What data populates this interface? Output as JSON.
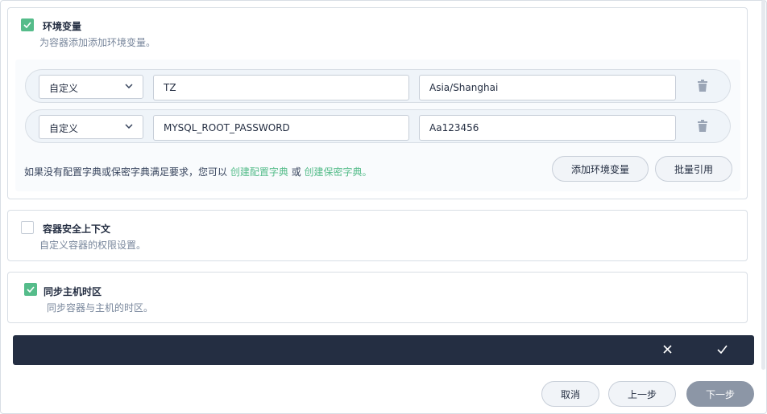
{
  "env": {
    "title": "环境变量",
    "description": "为容器添加添加环境变量。",
    "checked": true,
    "rows": [
      {
        "type": "自定义",
        "key": "TZ",
        "value": "Asia/Shanghai"
      },
      {
        "type": "自定义",
        "key": "MYSQL_ROOT_PASSWORD",
        "value": "Aa123456"
      }
    ],
    "hint_prefix": "如果没有配置字典或保密字典满足要求，您可以",
    "hint_link_configmap": "创建配置字典",
    "hint_or": "或",
    "hint_link_secret": "创建保密字典。",
    "add_button": "添加环境变量",
    "batch_button": "批量引用"
  },
  "security_context": {
    "title": "容器安全上下文",
    "description": "自定义容器的权限设置。",
    "checked": false
  },
  "timezone": {
    "title": "同步主机时区",
    "description": "同步容器与主机的时区。",
    "checked": true
  },
  "footer": {
    "cancel": "取消",
    "previous": "上一步",
    "next": "下一步"
  },
  "colors": {
    "accent": "#55bc8a",
    "dark_bar": "#242e42",
    "primary_disabled": "#8c96a6"
  }
}
